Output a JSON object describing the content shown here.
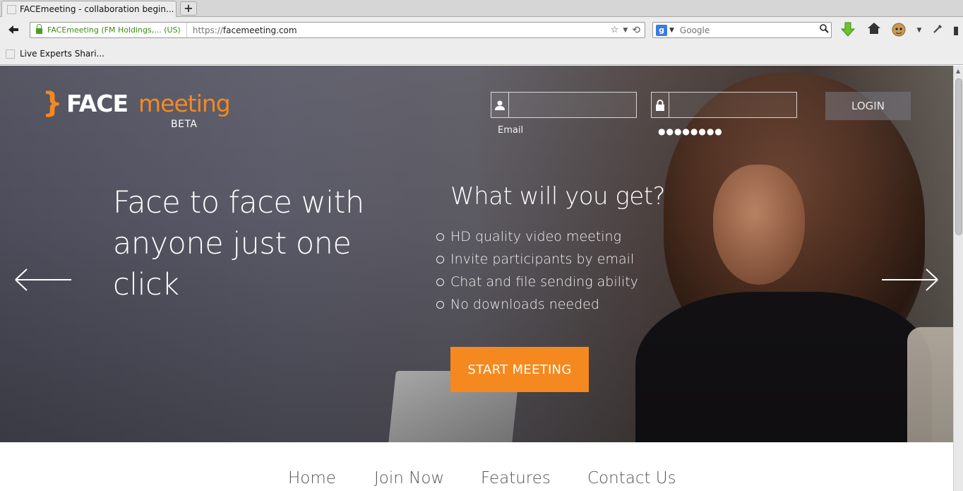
{
  "browser": {
    "tab_title": "FACEmeeting - collaboration begin...",
    "new_tab_label": "+",
    "identity_label": "FACEmeeting (FM Holdings,... (US)",
    "url_prefix": "https://",
    "url_host": "facemeeting.com",
    "search_placeholder": "Google",
    "search_engine_badge": "g",
    "bookmark_label": "Live Experts Shari..."
  },
  "header": {
    "logo_brace": "}",
    "logo_face": "FACE",
    "logo_meeting": "meeting",
    "logo_beta": "BETA",
    "email_hint": "Email",
    "password_dots": "●●●●●●●●",
    "login_label": "LOGIN"
  },
  "hero": {
    "headline": "Face to face with anyone just one click",
    "get_title": "What will you get?",
    "features": [
      "HD quality video meeting",
      "Invite participants by email",
      "Chat and file sending ability",
      "No downloads needed"
    ],
    "start_label": "START MEETING"
  },
  "nav": {
    "items": [
      "Home",
      "Join Now",
      "Features",
      "Contact Us"
    ]
  },
  "colors": {
    "accent": "#f5891f",
    "identity_green": "#3a8d14"
  }
}
